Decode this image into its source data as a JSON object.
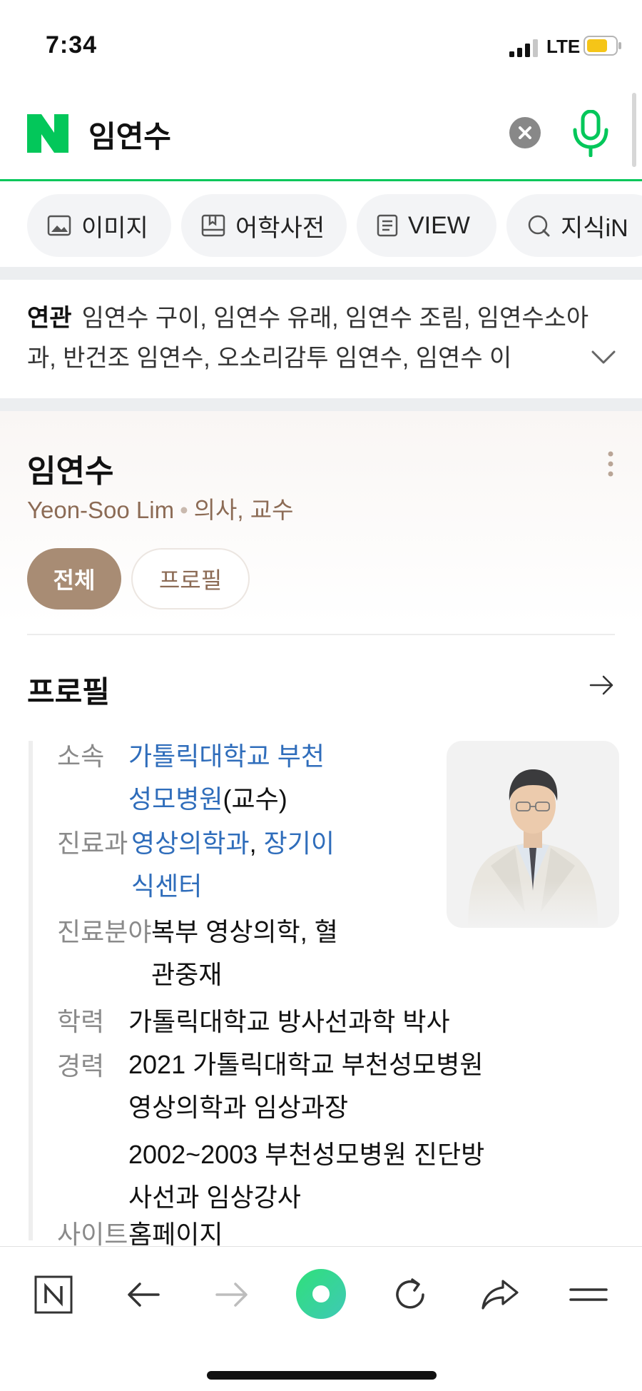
{
  "status_bar": {
    "time": "7:34",
    "network": "LTE"
  },
  "search": {
    "query": "임연수"
  },
  "tabs": [
    {
      "label": "이미지",
      "icon": "image-icon"
    },
    {
      "label": "어학사전",
      "icon": "dictionary-icon"
    },
    {
      "label": "VIEW",
      "icon": "document-icon"
    },
    {
      "label": "지식iN",
      "icon": "search-q-icon"
    }
  ],
  "related": {
    "label": "연관",
    "text": "임연수 구이, 임연수 유래, 임연수 조림, 임연수소아과, 반건조 임연수, 오소리감투 임연수, 임연수 이"
  },
  "profile": {
    "name": "임연수",
    "english_name": "Yeon-Soo Lim",
    "separator": "•",
    "occupation": "의사, 교수",
    "pills": {
      "all": "전체",
      "profile": "프로필"
    },
    "section_title": "프로필",
    "rows": {
      "affiliation": {
        "label": "소속",
        "link": "가톨릭대학교 부천성모병원",
        "suffix": "(교수)"
      },
      "department": {
        "label": "진료과",
        "link1": "영상의학과",
        "comma": ", ",
        "link2": "장기이식센터"
      },
      "specialty": {
        "label": "진료분야",
        "value": "복부 영상의학, 혈관중재"
      },
      "education": {
        "label": "학력",
        "link": "가톨릭대학교 방사선과학 박사"
      },
      "career": {
        "label": "경력",
        "items": [
          "2021 가톨릭대학교 부천성모병원 영상의학과 임상과장",
          "2002~2003 부천성모병원 진단방사선과 임상강사"
        ]
      },
      "site": {
        "label": "사이트",
        "link": "홈페이지"
      }
    }
  },
  "colors": {
    "naver_green": "#03c75a",
    "brown_accent": "#a88c74",
    "link_blue": "#2f6dbb",
    "battery_yellow": "#f5c518"
  }
}
